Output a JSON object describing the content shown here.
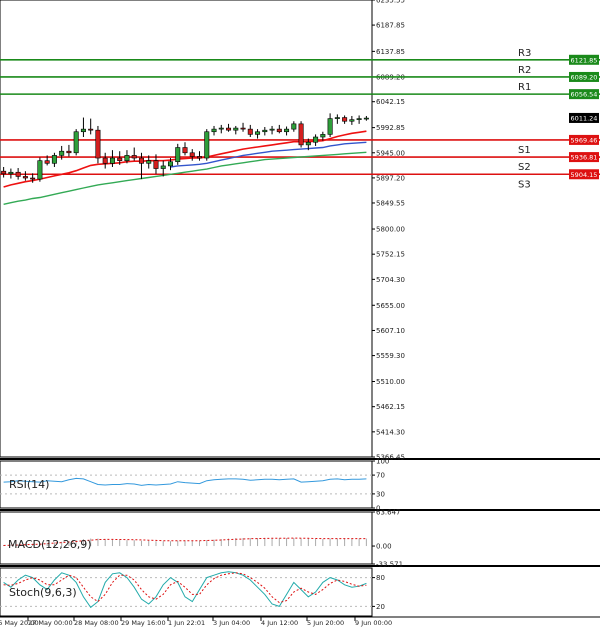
{
  "chart_data": [
    {
      "type": "candlestick",
      "panel": "price",
      "ylim": [
        5366.45,
        6235.55
      ],
      "y_ticks": [
        "6235.55",
        "6187.85",
        "6137.85",
        "6089.20",
        "6042.15",
        "5992.85",
        "5945.00",
        "5897.20",
        "5849.55",
        "5800.00",
        "5752.15",
        "5704.30",
        "5655.00",
        "5607.10",
        "5559.30",
        "5510.00",
        "5462.15",
        "5414.30",
        "5366.45"
      ],
      "x_ticks": [
        "26 May 20:00",
        "27 May 00:00",
        "28 May 08:00",
        "29 May 16:00",
        "1 Jun 22:01",
        "3 Jun 04:00",
        "4 Jun 12:00",
        "5 Jun 20:00",
        "9 Jun 00:00"
      ],
      "ohlc": [
        [
          5910,
          5918,
          5898,
          5905
        ],
        [
          5905,
          5915,
          5896,
          5908
        ],
        [
          5908,
          5916,
          5894,
          5900
        ],
        [
          5900,
          5910,
          5892,
          5897
        ],
        [
          5897,
          5906,
          5888,
          5895
        ],
        [
          5895,
          5936,
          5890,
          5930
        ],
        [
          5930,
          5940,
          5921,
          5925
        ],
        [
          5925,
          5945,
          5918,
          5940
        ],
        [
          5940,
          5958,
          5932,
          5948
        ],
        [
          5948,
          5960,
          5938,
          5945
        ],
        [
          5945,
          5990,
          5940,
          5985
        ],
        [
          5985,
          6012,
          5975,
          5990
        ],
        [
          5990,
          6010,
          5980,
          5988
        ],
        [
          5988,
          5996,
          5925,
          5935
        ],
        [
          5935,
          5945,
          5915,
          5925
        ],
        [
          5925,
          5950,
          5918,
          5935
        ],
        [
          5935,
          5948,
          5922,
          5930
        ],
        [
          5930,
          5950,
          5925,
          5940
        ],
        [
          5940,
          5955,
          5930,
          5935
        ],
        [
          5935,
          5945,
          5895,
          5925
        ],
        [
          5925,
          5940,
          5915,
          5930
        ],
        [
          5930,
          5942,
          5905,
          5915
        ],
        [
          5915,
          5930,
          5900,
          5920
        ],
        [
          5920,
          5935,
          5912,
          5928
        ],
        [
          5928,
          5962,
          5922,
          5955
        ],
        [
          5955,
          5965,
          5940,
          5945
        ],
        [
          5945,
          5952,
          5930,
          5938
        ],
        [
          5938,
          5948,
          5930,
          5935
        ],
        [
          5935,
          5990,
          5930,
          5985
        ],
        [
          5985,
          5996,
          5978,
          5990
        ],
        [
          5990,
          5998,
          5982,
          5992
        ],
        [
          5992,
          6000,
          5985,
          5988
        ],
        [
          5988,
          5996,
          5980,
          5992
        ],
        [
          5992,
          6002,
          5985,
          5990
        ],
        [
          5990,
          5998,
          5975,
          5980
        ],
        [
          5980,
          5990,
          5972,
          5985
        ],
        [
          5985,
          5994,
          5978,
          5988
        ],
        [
          5988,
          5996,
          5980,
          5990
        ],
        [
          5990,
          5998,
          5982,
          5985
        ],
        [
          5985,
          5995,
          5978,
          5990
        ],
        [
          5990,
          6005,
          5985,
          6000
        ],
        [
          6000,
          6005,
          5955,
          5960
        ],
        [
          5960,
          5972,
          5950,
          5965
        ],
        [
          5965,
          5980,
          5958,
          5975
        ],
        [
          5975,
          5985,
          5968,
          5980
        ],
        [
          5980,
          6020,
          5975,
          6010
        ],
        [
          6010,
          6018,
          6000,
          6012
        ],
        [
          6012,
          6016,
          6000,
          6005
        ],
        [
          6005,
          6015,
          5998,
          6008
        ],
        [
          6008,
          6016,
          6000,
          6010
        ],
        [
          6010,
          6015,
          6006,
          6011
        ]
      ],
      "moving_averages": [
        {
          "color": "#ee1111",
          "values": [
            5880,
            5884,
            5887,
            5890,
            5892,
            5895,
            5898,
            5901,
            5904,
            5907,
            5911,
            5916,
            5921,
            5923,
            5924,
            5925,
            5926,
            5928,
            5929,
            5929,
            5930,
            5930,
            5930,
            5931,
            5933,
            5934,
            5935,
            5935,
            5937,
            5940,
            5943,
            5946,
            5949,
            5952,
            5954,
            5956,
            5958,
            5960,
            5962,
            5964,
            5966,
            5966,
            5966,
            5967,
            5968,
            5972,
            5976,
            5979,
            5982,
            5984,
            5986
          ]
        },
        {
          "color": "#3355cc",
          "values": [
            null,
            null,
            null,
            null,
            null,
            null,
            null,
            null,
            null,
            null,
            null,
            null,
            null,
            null,
            null,
            null,
            null,
            null,
            null,
            null,
            null,
            null,
            null,
            5918,
            5920,
            5921,
            5922,
            5923,
            5925,
            5928,
            5931,
            5934,
            5937,
            5940,
            5942,
            5944,
            5946,
            5948,
            5949,
            5950,
            5951,
            5952,
            5953,
            5954,
            5955,
            5958,
            5960,
            5962,
            5963,
            5964,
            5965
          ]
        },
        {
          "color": "#33aa55",
          "values": [
            5847,
            5850,
            5853,
            5855,
            5858,
            5860,
            5863,
            5866,
            5869,
            5872,
            5875,
            5878,
            5881,
            5884,
            5886,
            5888,
            5890,
            5892,
            5894,
            5896,
            5898,
            5900,
            5902,
            5904,
            5906,
            5908,
            5910,
            5912,
            5914,
            5917,
            5920,
            5922,
            5924,
            5926,
            5928,
            5930,
            5932,
            5933,
            5934,
            5935,
            5936,
            5937,
            5938,
            5939,
            5940,
            5941,
            5942,
            5943,
            5944,
            5945,
            5946
          ]
        }
      ],
      "levels": [
        {
          "name": "R3",
          "value": 6121.85,
          "label": "6121.85",
          "color": "#1a8a1a"
        },
        {
          "name": "R2",
          "value": 6089.2,
          "label": "6089.20",
          "color": "#1a8a1a"
        },
        {
          "name": "R1",
          "value": 6056.54,
          "label": "6056.54",
          "color": "#1a8a1a"
        },
        {
          "name": "S1",
          "value": 5969.46,
          "label": "5969.46",
          "color": "#dd1111"
        },
        {
          "name": "S2",
          "value": 5936.81,
          "label": "5936.81",
          "color": "#dd1111"
        },
        {
          "name": "S3",
          "value": 5904.15,
          "label": "5904.15",
          "color": "#dd1111"
        }
      ],
      "last_price": {
        "value": 6011.24,
        "label": "6011.24"
      }
    },
    {
      "type": "line",
      "panel": "indicator",
      "title": "RSI(14)",
      "ylim": [
        0,
        100
      ],
      "y_ticks": [
        "100",
        "70",
        "30",
        "0"
      ],
      "color": "#3399dd",
      "values": [
        55,
        56,
        58,
        57,
        56,
        55,
        58,
        57,
        56,
        60,
        63,
        62,
        56,
        50,
        49,
        50,
        50,
        52,
        51,
        48,
        50,
        49,
        50,
        51,
        56,
        54,
        53,
        52,
        58,
        60,
        61,
        62,
        62,
        61,
        59,
        60,
        61,
        61,
        60,
        61,
        62,
        55,
        56,
        57,
        58,
        61,
        62,
        60,
        61,
        61,
        62
      ]
    },
    {
      "type": "histogram",
      "panel": "indicator",
      "title": "MACD(12,26,9)",
      "ylim": [
        -33.571,
        63.647
      ],
      "y_ticks": [
        "63.647",
        "0.00",
        "-33.571"
      ],
      "histogram": [
        2,
        3,
        3,
        3,
        4,
        5,
        6,
        7,
        8,
        9,
        11,
        13,
        14,
        14,
        13,
        12,
        12,
        11,
        11,
        10,
        10,
        9,
        9,
        9,
        10,
        10,
        10,
        10,
        11,
        12,
        13,
        14,
        15,
        15,
        15,
        15,
        15,
        15,
        15,
        15,
        15,
        14,
        14,
        13,
        13,
        14,
        14,
        14,
        14,
        14,
        14
      ],
      "signal": [
        1,
        1.5,
        2,
        2.5,
        3,
        3.5,
        4.5,
        5.5,
        6.5,
        7.5,
        8.5,
        10,
        11,
        12,
        12.5,
        12.5,
        12.2,
        12,
        11.8,
        11.5,
        11,
        10.5,
        10,
        9.8,
        9.8,
        9.8,
        9.9,
        10,
        10.3,
        10.8,
        11.3,
        12,
        12.6,
        13.2,
        13.7,
        14,
        14.3,
        14.5,
        14.6,
        14.7,
        14.8,
        14.6,
        14.4,
        14.1,
        13.9,
        13.9,
        14,
        14,
        14,
        14,
        14
      ],
      "color": "#dd1111"
    },
    {
      "type": "line",
      "panel": "indicator",
      "title": "Stoch(9,6,3)",
      "ylim": [
        0,
        100
      ],
      "y_ticks": [
        "80",
        "20"
      ],
      "series": [
        {
          "color": "#22aaaa",
          "values": [
            70,
            60,
            75,
            85,
            80,
            65,
            55,
            75,
            90,
            85,
            70,
            40,
            18,
            30,
            70,
            88,
            90,
            80,
            60,
            35,
            25,
            40,
            65,
            80,
            70,
            40,
            30,
            55,
            80,
            85,
            90,
            92,
            90,
            85,
            75,
            60,
            45,
            25,
            20,
            45,
            70,
            55,
            40,
            50,
            70,
            80,
            75,
            65,
            60,
            62,
            68
          ]
        },
        {
          "color": "#dd1111",
          "values": [
            65,
            64,
            68,
            75,
            80,
            75,
            65,
            65,
            75,
            85,
            80,
            60,
            40,
            30,
            45,
            70,
            85,
            85,
            75,
            55,
            40,
            35,
            45,
            65,
            72,
            60,
            45,
            45,
            65,
            78,
            85,
            88,
            90,
            88,
            80,
            70,
            58,
            40,
            28,
            32,
            50,
            58,
            50,
            45,
            55,
            68,
            75,
            72,
            66,
            62,
            64
          ]
        }
      ]
    }
  ]
}
